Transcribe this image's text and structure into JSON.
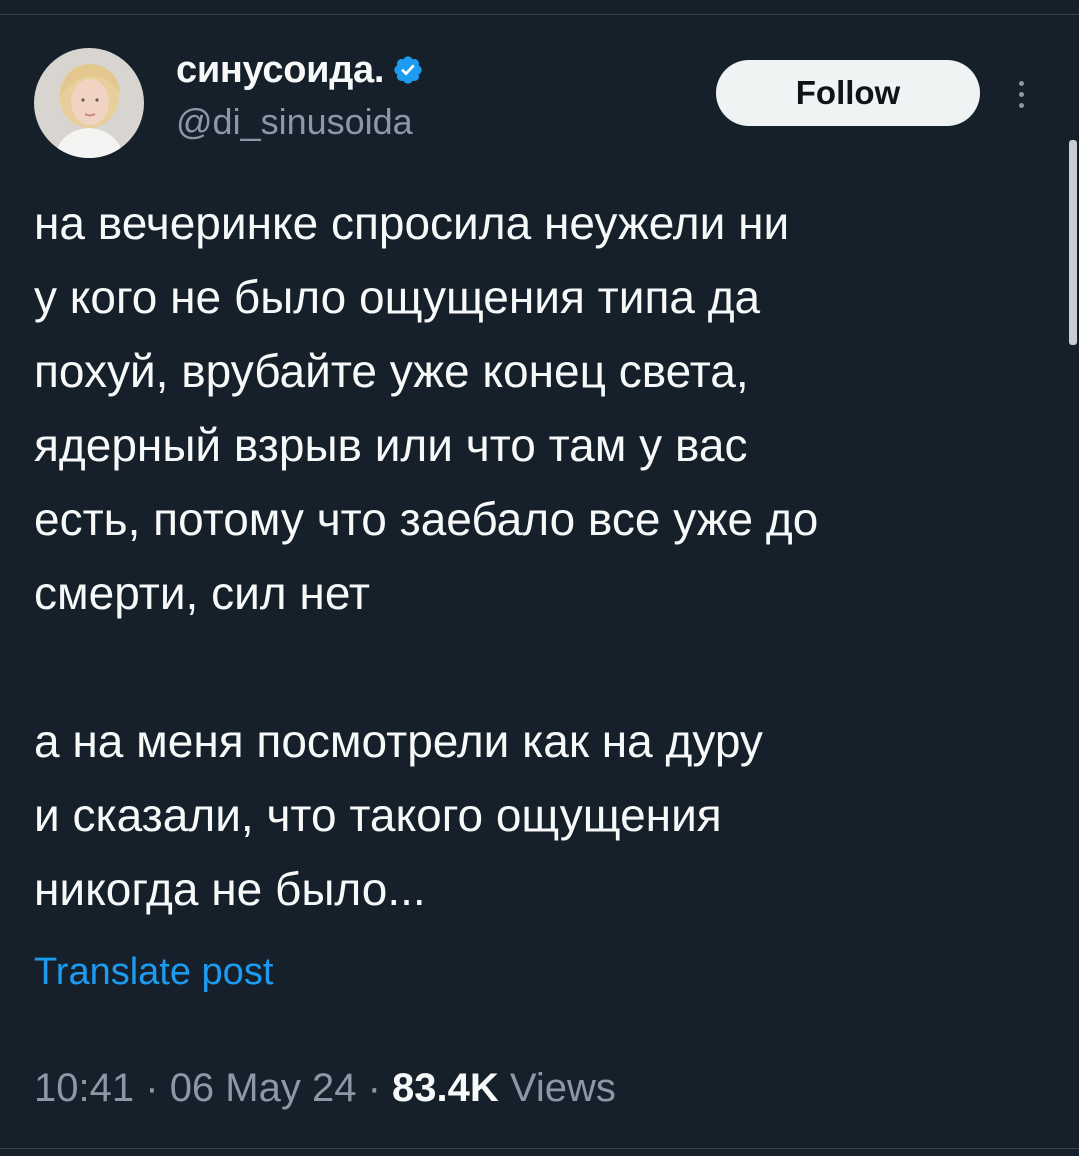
{
  "author": {
    "display_name": "синусоида.",
    "handle": "@di_sinusoida",
    "verified": true,
    "verified_icon": "verified-badge-icon"
  },
  "actions": {
    "follow_label": "Follow",
    "more_icon": "more-vertical-icon"
  },
  "tweet": {
    "paragraph_1": "на вечеринке спросила неужели ни\nу кого не было ощущения типа да\nпохуй, врубайте уже конец света,\nядерный взрыв или что там у вас\nесть, потому что заебало все уже до\nсмерти, сил нет",
    "paragraph_2": "а на меня посмотрели как на дуру\nи сказали, что такого ощущения\nникогда не было..."
  },
  "translate_label": "Translate post",
  "meta": {
    "time": "10:41",
    "separator": "·",
    "date": "06 May 24",
    "views_count": "83.4K",
    "views_label": "Views"
  },
  "colors": {
    "background": "#15202b",
    "text": "#f7f9f9",
    "secondary": "#8b98a5",
    "accent": "#1d9bf0"
  }
}
